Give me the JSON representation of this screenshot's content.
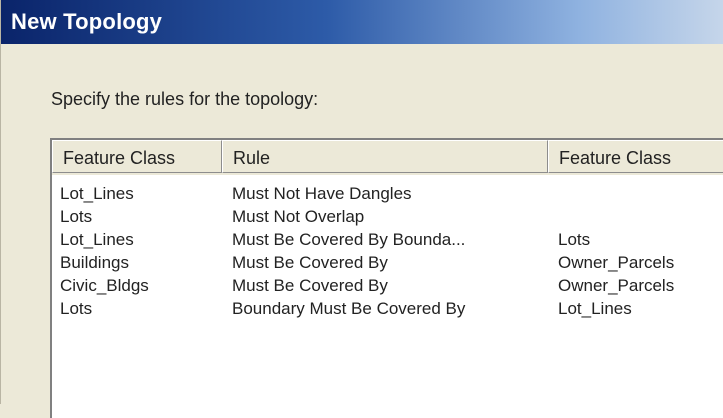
{
  "window": {
    "title": "New Topology"
  },
  "dialog": {
    "prompt": "Specify the rules for the topology:"
  },
  "rules_table": {
    "columns": [
      "Feature Class",
      "Rule",
      "Feature Class"
    ],
    "rows": [
      {
        "feature_class": "Lot_Lines",
        "rule": "Must Not Have Dangles",
        "feature_class_2": ""
      },
      {
        "feature_class": "Lots",
        "rule": "Must Not Overlap",
        "feature_class_2": ""
      },
      {
        "feature_class": "Lot_Lines",
        "rule": "Must Be Covered By Bounda...",
        "feature_class_2": "Lots"
      },
      {
        "feature_class": "Buildings",
        "rule": "Must Be Covered By",
        "feature_class_2": "Owner_Parcels"
      },
      {
        "feature_class": "Civic_Bldgs",
        "rule": "Must Be Covered By",
        "feature_class_2": "Owner_Parcels"
      },
      {
        "feature_class": "Lots",
        "rule": "Boundary Must Be Covered By",
        "feature_class_2": "Lot_Lines"
      }
    ]
  },
  "colors": {
    "titlebar_start": "#0a246a",
    "titlebar_end": "#c6d6ea",
    "dialog_background": "#ece9d8"
  }
}
